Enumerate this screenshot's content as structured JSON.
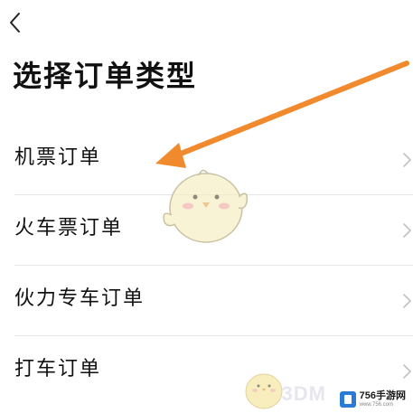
{
  "header": {
    "back_icon": "chevron-left-icon",
    "title": "选择订单类型"
  },
  "order_types": [
    {
      "label": "机票订单"
    },
    {
      "label": "火车票订单"
    },
    {
      "label": "伙力专车订单"
    },
    {
      "label": "打车订单"
    }
  ],
  "annotation": {
    "color": "#f08a2c",
    "points_to": "机票订单"
  },
  "watermark": {
    "name": "756手游网",
    "url": "www.756.com",
    "overlay_text": "3DM"
  },
  "colors": {
    "background": "#ffffff",
    "text": "#111111",
    "divider": "#e6e6e6",
    "chevron": "#c2c2c2"
  }
}
